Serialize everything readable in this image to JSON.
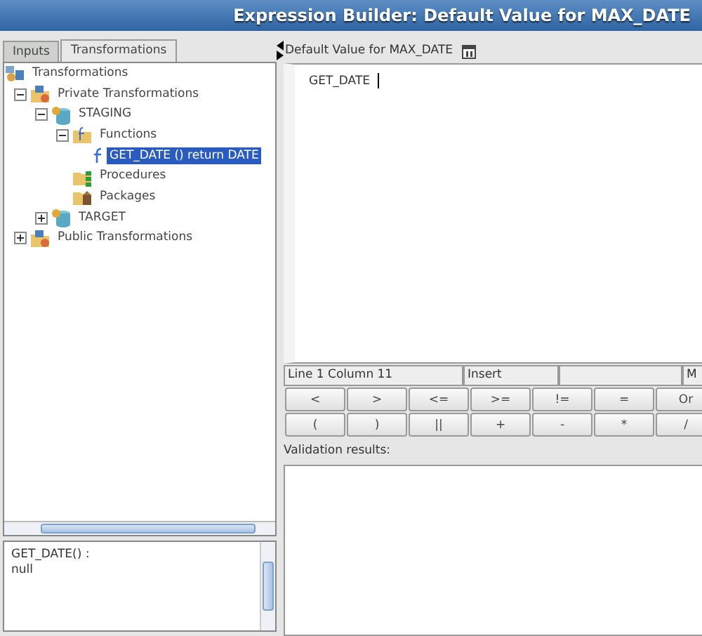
{
  "window": {
    "title": "Expression Builder: Default Value for MAX_DATE"
  },
  "tabs": [
    {
      "label": "Inputs",
      "selected": false
    },
    {
      "label": "Transformations",
      "selected": true
    }
  ],
  "tree": [
    {
      "label": "Transformations",
      "kind": "root",
      "selected": false,
      "children": [
        {
          "label": "Private Transformations",
          "kind": "group",
          "expanded": true,
          "selected": false,
          "children": [
            {
              "label": "STAGING",
              "kind": "schema",
              "expanded": true,
              "selected": false,
              "children": [
                {
                  "label": "Functions",
                  "kind": "functions",
                  "expanded": true,
                  "selected": false,
                  "children": [
                    {
                      "label": "GET_DATE () return DATE",
                      "kind": "function",
                      "selected": true
                    }
                  ]
                },
                {
                  "label": "Procedures",
                  "kind": "procedures",
                  "selected": false
                },
                {
                  "label": "Packages",
                  "kind": "packages",
                  "selected": false
                }
              ]
            },
            {
              "label": "TARGET",
              "kind": "schema",
              "expanded": false,
              "selected": false
            }
          ]
        },
        {
          "label": "Public Transformations",
          "kind": "group",
          "expanded": false,
          "selected": false
        }
      ]
    }
  ],
  "description": [
    "GET_DATE() :",
    "null"
  ],
  "editor": {
    "label": "Default Value for MAX_DATE",
    "value": "GET_DATE"
  },
  "status_bar": [
    "Line 1 Column 11",
    "Insert",
    "M"
  ],
  "operator_rows": [
    [
      "<",
      ">",
      "<=",
      ">=",
      "!=",
      "=",
      "Or"
    ],
    [
      "(",
      ")",
      "||",
      "+",
      "-",
      "*",
      "/"
    ]
  ],
  "validation": {
    "label": "Validation results:"
  }
}
